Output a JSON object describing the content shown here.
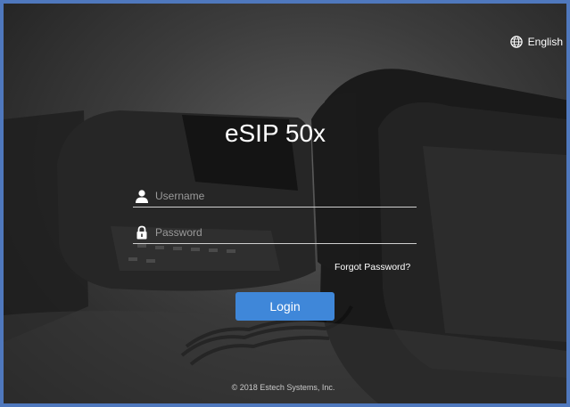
{
  "language": {
    "label": "English",
    "icon": "globe-icon"
  },
  "app": {
    "title": "eSIP 50x"
  },
  "login_form": {
    "username": {
      "placeholder": "Username",
      "value": "",
      "icon": "user-icon"
    },
    "password": {
      "placeholder": "Password",
      "value": "",
      "icon": "lock-icon"
    },
    "forgot_label": "Forgot Password?",
    "login_label": "Login"
  },
  "footer": {
    "copyright": "© 2018 Estech Systems, Inc."
  },
  "colors": {
    "border": "#4f78bd",
    "button": "#3f87d9",
    "text": "#ffffff"
  }
}
